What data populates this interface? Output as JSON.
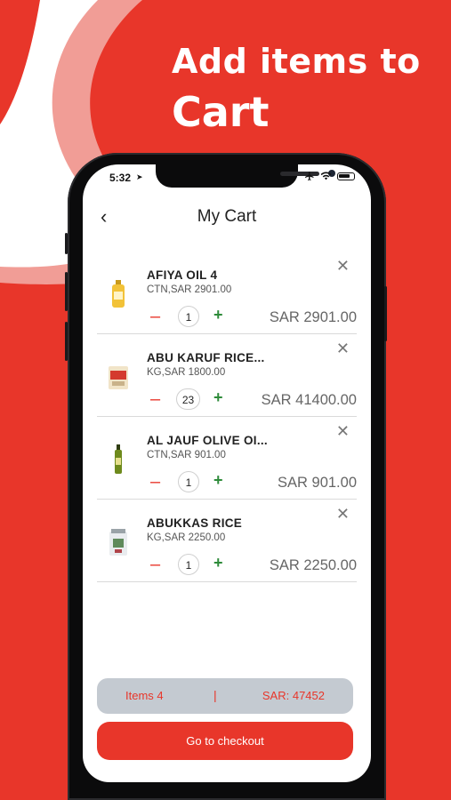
{
  "promo": {
    "line1": "Add items to",
    "line2": "Cart"
  },
  "status_bar": {
    "time": "5:32"
  },
  "header": {
    "title": "My Cart"
  },
  "cart_items": [
    {
      "name": "AFIYA OIL 4",
      "detail": "CTN,SAR 2901.00",
      "quantity": "1",
      "price": "SAR 2901.00"
    },
    {
      "name": "ABU KARUF RICE...",
      "detail": "KG,SAR 1800.00",
      "quantity": "23",
      "price": "SAR 41400.00"
    },
    {
      "name": "AL JAUF OLIVE OI...",
      "detail": "CTN,SAR 901.00",
      "quantity": "1",
      "price": "SAR 901.00"
    },
    {
      "name": "ABUKKAS RICE",
      "detail": "KG,SAR 2250.00",
      "quantity": "1",
      "price": "SAR 2250.00"
    }
  ],
  "summary": {
    "items": "Items 4",
    "separator": "|",
    "total": "SAR: 47452"
  },
  "checkout": {
    "label": "Go to checkout"
  },
  "colors": {
    "brand_red": "#e8362a",
    "plus_green": "#2e8b3a",
    "summary_bg": "#c4cad1"
  }
}
